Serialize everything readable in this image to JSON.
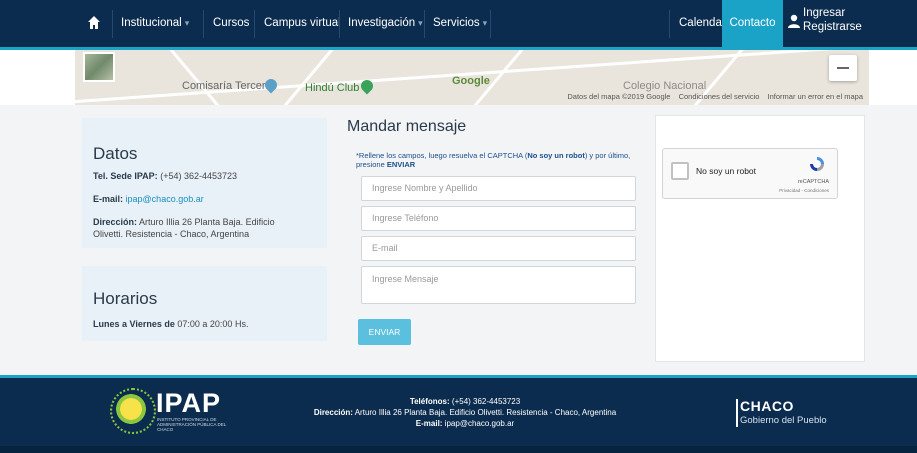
{
  "nav": {
    "home_icon": "home-icon",
    "items": [
      {
        "label": "Institucional",
        "dropdown": true
      },
      {
        "label": "Cursos",
        "dropdown": false
      },
      {
        "label": "Campus virtual",
        "dropdown": false
      },
      {
        "label": "Investigación",
        "dropdown": true
      },
      {
        "label": "Servicios",
        "dropdown": true
      }
    ],
    "calendar": "Calendario",
    "contact": "Contacto",
    "login": "Ingresar",
    "register": "Registrarse",
    "caret": "▾"
  },
  "map": {
    "labels": {
      "comisaria": "Comisaría Tercera",
      "hindu": "Hindú Club",
      "google": "Google",
      "colegio": "Colegio Nacional"
    },
    "footer": {
      "data": "Datos del mapa ©2019 Google",
      "terms": "Condiciones del servicio",
      "report": "Informar un error en el mapa"
    }
  },
  "datos": {
    "title": "Datos",
    "tel_label": "Tel. Sede IPAP:",
    "tel_value": "(+54) 362-4453723",
    "email_label": "E-mail:",
    "email_value": "ipap@chaco.gob.ar",
    "address_label": "Dirección:",
    "address_line1": "Arturo Illia 26 Planta Baja. Edificio",
    "address_line2": "Olivetti. Resistencia - Chaco, Argentina"
  },
  "horarios": {
    "title": "Horarios",
    "days_label": "Lunes a Viernes de",
    "hours": "07:00 a 20:00 Hs."
  },
  "form": {
    "title": "Mandar mensaje",
    "note_part1": "*Rellene los campos, luego resuelva el CAPTCHA (",
    "note_bold1": "No soy un robot",
    "note_part2": ") y por último, presione ",
    "note_bold2": "ENVIAR",
    "name_placeholder": "Ingrese Nombre y Apellido",
    "phone_placeholder": "Ingrese Teléfono",
    "email_placeholder": "E-mail",
    "message_placeholder": "Ingrese Mensaje",
    "send_label": "ENVIAR"
  },
  "captcha": {
    "label": "No soy un robot",
    "brand": "reCAPTCHA",
    "terms": "Privacidad - Condiciones"
  },
  "footer": {
    "logo_word": "IPAP",
    "logo_sub": "INSTITUTO PROVINCIAL DE ADMINISTRACIÓN PÚBLICA DEL CHACO",
    "phones_label": "Teléfonos:",
    "phones_value": "(+54) 362-4453723",
    "address_label": "Dirección:",
    "address_value": "Arturo Illia 26 Planta Baja. Edificio Olivetti. Resistencia - Chaco, Argentina",
    "email_label": "E-mail:",
    "email_value": "ipap@chaco.gob.ar",
    "chaco": "CHACO",
    "chaco_sub": "Gobierno del Pueblo"
  },
  "colors": {
    "nav_bg": "#0b2c4e",
    "accent": "#1aa3c7",
    "button": "#5bc0de"
  }
}
